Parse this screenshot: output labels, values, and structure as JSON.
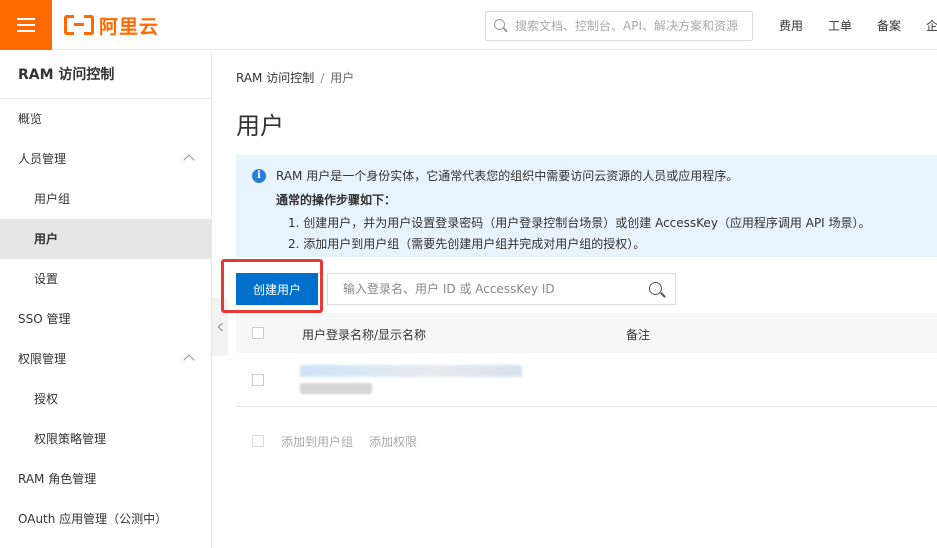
{
  "topbar": {
    "logo_text": "阿里云",
    "search_placeholder": "搜索文档、控制台、API、解决方案和资源",
    "nav": [
      "费用",
      "工单",
      "备案",
      "企"
    ],
    "brand_color": "#ff6a00"
  },
  "sidebar": {
    "title": "RAM 访问控制",
    "items": [
      {
        "label": "概览"
      },
      {
        "label": "人员管理",
        "expanded": true
      },
      {
        "label": "用户组",
        "sub": true
      },
      {
        "label": "用户",
        "sub": true,
        "active": true
      },
      {
        "label": "设置",
        "sub": true
      },
      {
        "label": "SSO 管理"
      },
      {
        "label": "权限管理",
        "expanded": true
      },
      {
        "label": "授权",
        "sub": true
      },
      {
        "label": "权限策略管理",
        "sub": true
      },
      {
        "label": "RAM 角色管理"
      },
      {
        "label": "OAuth 应用管理（公测中）"
      }
    ]
  },
  "main": {
    "breadcrumb": {
      "root": "RAM 访问控制",
      "separator": "/",
      "current": "用户"
    },
    "title": "用户",
    "notice": {
      "line1": "RAM 用户是一个身份实体，它通常代表您的组织中需要访问云资源的人员或应用程序。",
      "line2": "通常的操作步骤如下：",
      "line3": "1. 创建用户，并为用户设置登录密码（用户登录控制台场景）或创建 AccessKey（应用程序调用 API 场景）。",
      "line4": "2. 添加用户到用户组（需要先创建用户组并完成对用户组的授权）。",
      "icon": "info-icon"
    },
    "create_button": "创建用户",
    "search_placeholder": "输入登录名、用户 ID 或 AccessKey ID",
    "table": {
      "columns": [
        "用户登录名称/显示名称",
        "备注"
      ]
    },
    "footer_actions": [
      "添加到用户组",
      "添加权限"
    ],
    "accent_color": "#0070cc"
  }
}
